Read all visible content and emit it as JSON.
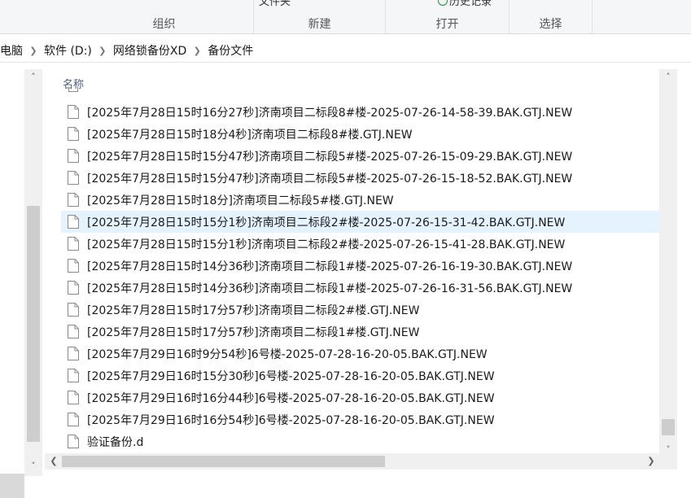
{
  "ribbon": {
    "groups": [
      {
        "label": "组织"
      },
      {
        "label": "新建",
        "top_text": "文件夹"
      },
      {
        "label": "打开",
        "top_text": "历史记录"
      },
      {
        "label": "选择"
      }
    ]
  },
  "breadcrumb": [
    {
      "label": "电脑"
    },
    {
      "label": "软件 (D:)"
    },
    {
      "label": "网络锁备份XD"
    },
    {
      "label": "备份文件"
    }
  ],
  "file_list": {
    "column_header": "名称",
    "selected_index": 5,
    "files": [
      {
        "name": "[2025年7月28日15时16分27秒]济南项目二标段8#楼-2025-07-26-14-58-39.BAK.GTJ.NEW"
      },
      {
        "name": "[2025年7月28日15时18分4秒]济南项目二标段8#楼.GTJ.NEW"
      },
      {
        "name": "[2025年7月28日15时15分47秒]济南项目二标段5#楼-2025-07-26-15-09-29.BAK.GTJ.NEW"
      },
      {
        "name": "[2025年7月28日15时15分47秒]济南项目二标段5#楼-2025-07-26-15-18-52.BAK.GTJ.NEW"
      },
      {
        "name": "[2025年7月28日15时18分]济南项目二标段5#楼.GTJ.NEW"
      },
      {
        "name": "[2025年7月28日15时15分1秒]济南项目二标段2#楼-2025-07-26-15-31-42.BAK.GTJ.NEW"
      },
      {
        "name": "[2025年7月28日15时15分1秒]济南项目二标段2#楼-2025-07-26-15-41-28.BAK.GTJ.NEW"
      },
      {
        "name": "[2025年7月28日15时14分36秒]济南项目二标段1#楼-2025-07-26-16-19-30.BAK.GTJ.NEW"
      },
      {
        "name": "[2025年7月28日15时14分36秒]济南项目二标段1#楼-2025-07-26-16-31-56.BAK.GTJ.NEW"
      },
      {
        "name": "[2025年7月28日15时17分57秒]济南项目二标段2#楼.GTJ.NEW"
      },
      {
        "name": "[2025年7月28日15时17分57秒]济南项目二标段1#楼.GTJ.NEW"
      },
      {
        "name": "[2025年7月29日16时9分54秒]6号楼-2025-07-28-16-20-05.BAK.GTJ.NEW"
      },
      {
        "name": "[2025年7月29日16时15分30秒]6号楼-2025-07-28-16-20-05.BAK.GTJ.NEW"
      },
      {
        "name": "[2025年7月29日16时16分44秒]6号楼-2025-07-28-16-20-05.BAK.GTJ.NEW"
      },
      {
        "name": "[2025年7月29日16时16分54秒]6号楼-2025-07-28-16-20-05.BAK.GTJ.NEW"
      },
      {
        "name": "验证备份.d"
      }
    ]
  },
  "icons": {
    "file": "blank-file-icon",
    "breadcrumb_separator": "chevron-right-icon",
    "scroll_up": "chevron-up-icon",
    "scroll_down": "chevron-down-icon",
    "scroll_left": "chevron-left-icon",
    "scroll_right": "chevron-right-icon"
  },
  "colors": {
    "selected_row": "#e5f3ff",
    "column_header": "#4c607a",
    "scrollbar_track": "#f0f0f0",
    "scrollbar_thumb": "#cdcdcd"
  }
}
